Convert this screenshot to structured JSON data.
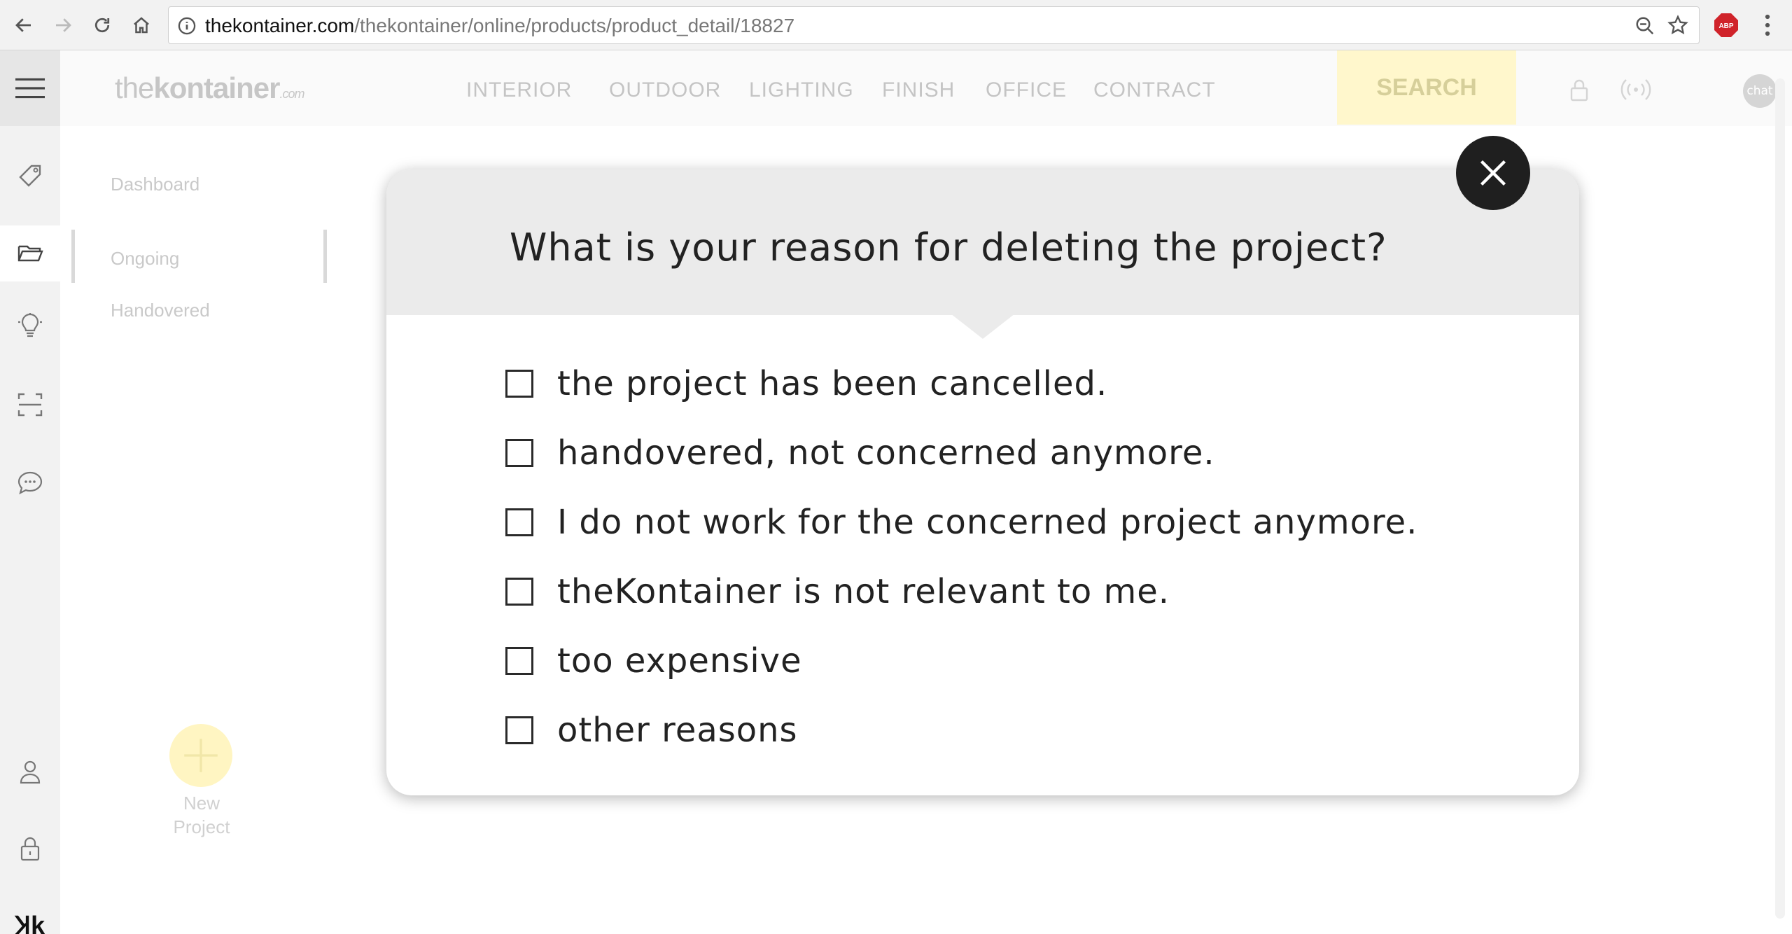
{
  "browser": {
    "url_host": "thekontainer.com",
    "url_path": "/thekontainer/online/products/product_detail/18827",
    "extension_label": "ABP"
  },
  "site": {
    "logo_light": "the",
    "logo_bold": "kontainer",
    "logo_suffix": ".com",
    "menu": [
      "INTERIOR",
      "OUTDOOR",
      "LIGHTING",
      "FINISH",
      "OFFICE",
      "CONTRACT"
    ],
    "search_label": "SEARCH",
    "chat_label": "chat",
    "brand_mark": "Ʞk"
  },
  "subnav": {
    "items": [
      "Dashboard",
      "Ongoing",
      "Handovered"
    ]
  },
  "new_project": {
    "label_line1": "New",
    "label_line2": "Project"
  },
  "modal": {
    "title": "What is your reason for deleting the project?",
    "options": [
      {
        "label": "the project has been cancelled.",
        "checked": false
      },
      {
        "label": "handovered, not concerned anymore.",
        "checked": false
      },
      {
        "label": "I do not work for the concerned project anymore.",
        "checked": false
      },
      {
        "label": "theKontainer is not relevant to me.",
        "checked": false
      },
      {
        "label": "too expensive",
        "checked": false
      },
      {
        "label": "other reasons",
        "checked": false
      }
    ]
  },
  "colors": {
    "accent_yellow": "#fff7cc",
    "modal_header": "#ebebeb",
    "close_button": "#1f1f1f"
  }
}
